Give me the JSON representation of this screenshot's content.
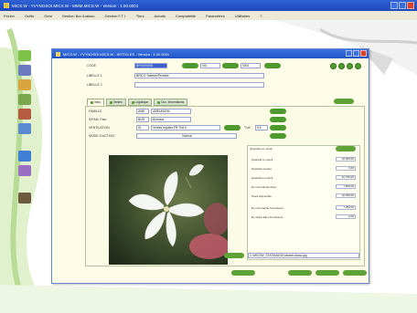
{
  "app": {
    "title": "MICS.W - YVYNOSOI.MICS.W - MMM.MICS.W - Version : 1.00.0001",
    "menu": [
      "Fichier",
      "Outils",
      "Gest",
      "Gestion Bur./Liaison",
      "Gestion F.T.I.",
      "Tiers",
      "Achats",
      "Comptabilité",
      "Paramètres",
      "Utilitaires",
      "?"
    ]
  },
  "doc": {
    "title": "MICS.W - YVYNOSOI.MICS.W - ARTICLES - Version : 1.00.0001",
    "code_label": "CODE",
    "code_value": "BRXXX0001",
    "code_extra1": "001",
    "code_extra2": "0001",
    "libelle1_label": "LIBELLE 1",
    "libelle1_value": "BRICO Tableau/Pendule",
    "libelle2_label": "LIBELLE 2",
    "libelle2_value": "",
    "tabs": [
      "Infos",
      "Ventes",
      "Logistique",
      "Doc. Informations"
    ],
    "famille_label": "FAMILLE",
    "famille_code": "AME",
    "famille_value": "AMEUBLEM.",
    "ss_famille_label": "S/FAM. Fam",
    "ss_famille_code": "BUR",
    "ss_famille_value": "Bureaux",
    "ventilation_label": "VENTILATION",
    "ventilation_code": "01",
    "ventilation_value": "Ventes régulier FR TVA 5",
    "tva_label": "TVA",
    "tva_value": "5,5",
    "mode_label": "MODE D'ACTION",
    "mode_value": "Normal",
    "stock_title": "Quantités en stock",
    "stock_rows": [
      {
        "label": "Quantité en stock",
        "value": "10 000,00"
      },
      {
        "label": "Quantité vendue",
        "value": "0,00"
      },
      {
        "label": "Quantité en stock",
        "value": "10 750,00"
      },
      {
        "label": "En commande client",
        "value": "7 500,00"
      },
      {
        "label": "Stock disponible",
        "value": "10 250,00"
      },
      {
        "label": "En commande fournisseur",
        "value": "7 250,00"
      },
      {
        "label": "En stock atlier fournisseur",
        "value": "0,00"
      }
    ],
    "image_path": "C:\\MICSW_STAT\\IMAGE\\Jasmin-blanc.jpg"
  },
  "colors": {
    "accent_green": "#4f9c31",
    "title_blue": "#2153c4"
  }
}
